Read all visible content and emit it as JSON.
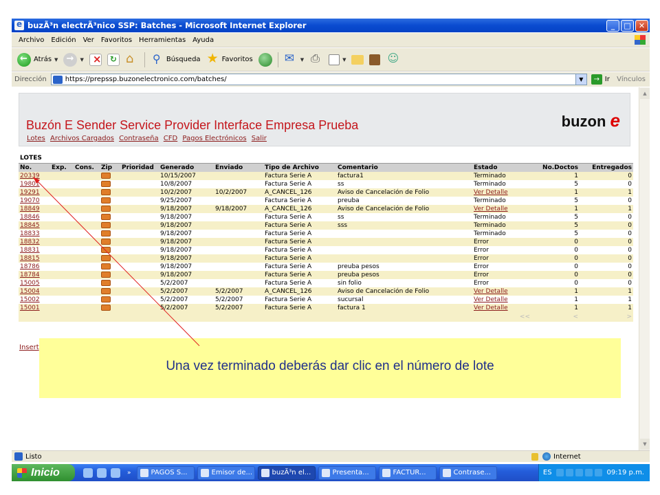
{
  "window": {
    "title": "buzÃ³n electrÃ³nico SSP: Batches - Microsoft Internet Explorer"
  },
  "menu": [
    "Archivo",
    "Edición",
    "Ver",
    "Favoritos",
    "Herramientas",
    "Ayuda"
  ],
  "toolbar": {
    "back_label": "Atrás",
    "search_label": "Búsqueda",
    "favorites_label": "Favoritos"
  },
  "address": {
    "label": "Dirección",
    "url": "https://prepssp.buzonelectronico.com/batches/",
    "go_label": "Ir",
    "links_label": "Vínculos"
  },
  "page": {
    "heading": "Buzón E Sender Service Provider Interface Empresa Prueba",
    "logo_text": "buzon",
    "logo_mark": "e",
    "nav": [
      "Lotes",
      "Archivos Cargados",
      "Contraseña",
      "CFD",
      "Pagos Electrónicos",
      "Salir"
    ],
    "section_title": "LOTES",
    "insert_link": "Insert"
  },
  "table": {
    "columns": [
      "No.",
      "Exp.",
      "Cons.",
      "Zip",
      "Prioridad",
      "Generado",
      "Enviado",
      "Tipo de Archivo",
      "Comentario",
      "Estado",
      "No.Doctos",
      "Entregados"
    ],
    "rows": [
      {
        "no": "20339",
        "generado": "10/15/2007",
        "enviado": "",
        "tipo": "Factura Serie A",
        "comentario": "factura1",
        "estado": "Terminado",
        "estado_link": false,
        "doctos": "1",
        "entregados": "0"
      },
      {
        "no": "19801",
        "generado": "10/8/2007",
        "enviado": "",
        "tipo": "Factura Serie A",
        "comentario": "ss",
        "estado": "Terminado",
        "estado_link": false,
        "doctos": "5",
        "entregados": "0"
      },
      {
        "no": "19291",
        "generado": "10/2/2007",
        "enviado": "10/2/2007",
        "tipo": "A_CANCEL_126",
        "comentario": "Aviso de Cancelación de Folio",
        "estado": "Ver Detalle",
        "estado_link": true,
        "doctos": "1",
        "entregados": "1"
      },
      {
        "no": "19070",
        "generado": "9/25/2007",
        "enviado": "",
        "tipo": "Factura Serie A",
        "comentario": "preuba",
        "estado": "Terminado",
        "estado_link": false,
        "doctos": "5",
        "entregados": "0"
      },
      {
        "no": "18849",
        "generado": "9/18/2007",
        "enviado": "9/18/2007",
        "tipo": "A_CANCEL_126",
        "comentario": "Aviso de Cancelación de Folio",
        "estado": "Ver Detalle",
        "estado_link": true,
        "doctos": "1",
        "entregados": "1"
      },
      {
        "no": "18846",
        "generado": "9/18/2007",
        "enviado": "",
        "tipo": "Factura Serie A",
        "comentario": "ss",
        "estado": "Terminado",
        "estado_link": false,
        "doctos": "5",
        "entregados": "0"
      },
      {
        "no": "18845",
        "generado": "9/18/2007",
        "enviado": "",
        "tipo": "Factura Serie A",
        "comentario": "sss",
        "estado": "Terminado",
        "estado_link": false,
        "doctos": "5",
        "entregados": "0"
      },
      {
        "no": "18833",
        "generado": "9/18/2007",
        "enviado": "",
        "tipo": "Factura Serie A",
        "comentario": "",
        "estado": "Terminado",
        "estado_link": false,
        "doctos": "5",
        "entregados": "0"
      },
      {
        "no": "18832",
        "generado": "9/18/2007",
        "enviado": "",
        "tipo": "Factura Serie A",
        "comentario": "",
        "estado": "Error",
        "estado_link": false,
        "doctos": "0",
        "entregados": "0"
      },
      {
        "no": "18831",
        "generado": "9/18/2007",
        "enviado": "",
        "tipo": "Factura Serie A",
        "comentario": "",
        "estado": "Error",
        "estado_link": false,
        "doctos": "0",
        "entregados": "0"
      },
      {
        "no": "18815",
        "generado": "9/18/2007",
        "enviado": "",
        "tipo": "Factura Serie A",
        "comentario": "",
        "estado": "Error",
        "estado_link": false,
        "doctos": "0",
        "entregados": "0"
      },
      {
        "no": "18786",
        "generado": "9/18/2007",
        "enviado": "",
        "tipo": "Factura Serie A",
        "comentario": "preuba pesos",
        "estado": "Error",
        "estado_link": false,
        "doctos": "0",
        "entregados": "0"
      },
      {
        "no": "18784",
        "generado": "9/18/2007",
        "enviado": "",
        "tipo": "Factura Serie A",
        "comentario": "preuba pesos",
        "estado": "Error",
        "estado_link": false,
        "doctos": "0",
        "entregados": "0"
      },
      {
        "no": "15005",
        "generado": "5/2/2007",
        "enviado": "",
        "tipo": "Factura Serie A",
        "comentario": "sin folio",
        "estado": "Error",
        "estado_link": false,
        "doctos": "0",
        "entregados": "0"
      },
      {
        "no": "15004",
        "generado": "5/2/2007",
        "enviado": "5/2/2007",
        "tipo": "A_CANCEL_126",
        "comentario": "Aviso de Cancelación de Folio",
        "estado": "Ver Detalle",
        "estado_link": true,
        "doctos": "1",
        "entregados": "1"
      },
      {
        "no": "15002",
        "generado": "5/2/2007",
        "enviado": "5/2/2007",
        "tipo": "Factura Serie A",
        "comentario": "sucursal",
        "estado": "Ver Detalle",
        "estado_link": true,
        "doctos": "1",
        "entregados": "1"
      },
      {
        "no": "15001",
        "generado": "5/2/2007",
        "enviado": "5/2/2007",
        "tipo": "Factura Serie A",
        "comentario": "factura 1",
        "estado": "Ver Detalle",
        "estado_link": true,
        "doctos": "1",
        "entregados": "1"
      }
    ],
    "pager": [
      "<<",
      "<",
      ">"
    ]
  },
  "callout": {
    "text": "Una vez terminado deberás dar clic en el número de lote"
  },
  "status": {
    "left": "Listo",
    "zone": "Internet"
  },
  "taskbar": {
    "start_label": "Inicio",
    "tasks": [
      "PAGOS S...",
      "Emisor de...",
      "buzÃ³n el...",
      "Presenta...",
      "FACTUR...",
      "Contrase..."
    ],
    "active_task": 2,
    "lang": "ES",
    "clock": "09:19 p.m."
  },
  "colors": {
    "link": "#8b1a1a",
    "heading": "#c4161c",
    "row_alt": "#f6f0c8",
    "callout_bg": "#ffff99",
    "callout_text": "#1f2f8a",
    "arrow": "#e02020"
  }
}
